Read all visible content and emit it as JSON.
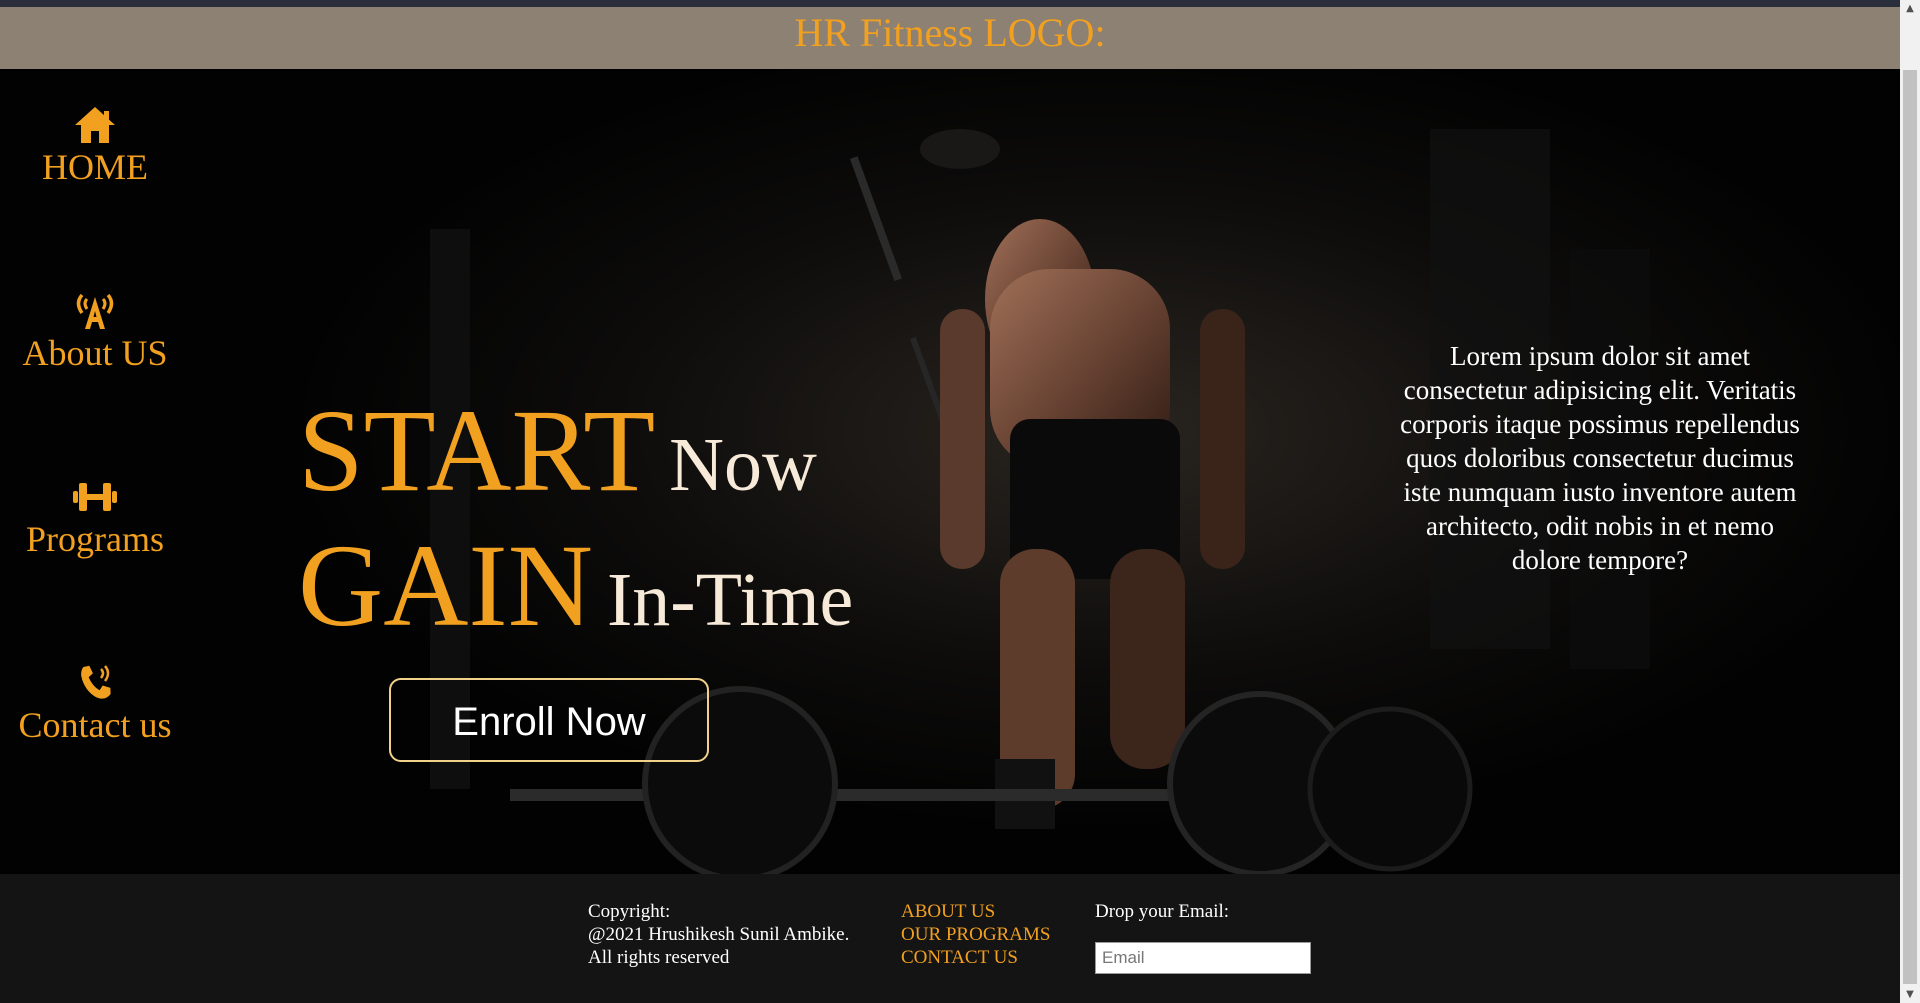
{
  "header": {
    "logo_text": "HR Fitness LOGO:"
  },
  "nav": {
    "items": [
      {
        "label": "HOME",
        "icon": "home-icon"
      },
      {
        "label": "About US",
        "icon": "broadcast-tower-icon"
      },
      {
        "label": "Programs",
        "icon": "dumbbell-icon"
      },
      {
        "label": "Contact us",
        "icon": "phone-volume-icon"
      }
    ]
  },
  "hero": {
    "line1_big": "START",
    "line1_small": "Now",
    "line2_big": "GAIN",
    "line2_small": "In-Time",
    "enroll_label": "Enroll Now",
    "blurb": "Lorem ipsum dolor sit amet consectetur adipisicing elit. Veritatis corporis itaque possimus repellendus quos doloribus consectetur ducimus iste numquam iusto inventore autem architecto, odit nobis in et nemo dolore tempore?"
  },
  "footer": {
    "copyright_heading": "Copyright:",
    "copyright_owner": "@2021 Hrushikesh Sunil Ambike.",
    "copyright_rights": "All rights reserved",
    "links": [
      "ABOUT US",
      "OUR PROGRAMS",
      "CONTACT US"
    ],
    "email_label": "Drop your Email:",
    "email_placeholder": "Email",
    "email_value": ""
  },
  "colors": {
    "accent": "#f2a020",
    "header_bg": "#8c8173",
    "footer_bg": "#151414",
    "hero_bg": "#020202"
  }
}
